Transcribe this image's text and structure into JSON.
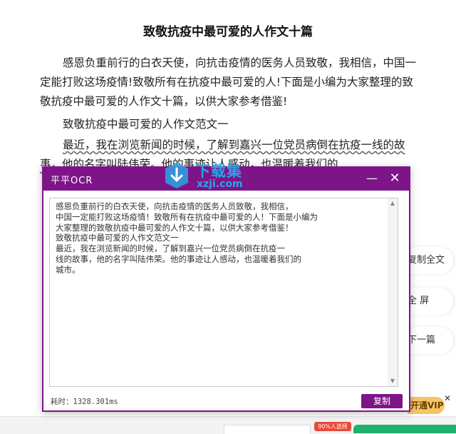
{
  "article": {
    "title": "致敬抗疫中最可爱的人作文十篇",
    "p1": "感恩负重前行的白衣天使，向抗击疫情的医务人员致敬，我相信，中国一定能打败这场疫情!致敬所有在抗疫中最可爱的人!下面是小编为大家整理的致敬抗疫中最可爱的人作文十篇，以供大家参考借鉴!",
    "p2": "致敬抗疫中最可爱的人作文范文一",
    "p3": "最近，我在浏览新闻的时候，了解到嘉兴一位党员病倒在抗疫一线的故事，他的名字叫陆伟荣。他的事迹让人感动，也温暖着我们的"
  },
  "side_actions": {
    "copy_all": "复制全文",
    "fullscreen": "全 屏",
    "next": "下一篇",
    "vip": "开通VIP"
  },
  "bottom": {
    "badge": "90%人选择"
  },
  "ocr_window": {
    "title": "平平OCR",
    "text": "感恩负重前行的白衣天使，向抗击疫情的医务人员致敬，我相信，\n中国一定能打败这场疫情！致敬所有在抗疫中最可爱的人！下面是小编为\n大家整理的致敬抗疫中最可爱的人作文十篇，以供大家参考借鉴！\n致敬抗疫中最可爱的人作文范文一\n最近，我在浏览新闻的时候，了解到嘉兴一位党员病倒在抗疫一\n线的故事，他的名字叫陆伟荣。他的事迹让人感动，也温暖着我们的\n城市。",
    "elapsed": "耗时：1328.301ms",
    "copy_button": "复制"
  },
  "watermark": {
    "line1": "下载集",
    "line2": "xzji.com"
  },
  "colors": {
    "ocr_purple": "#7d1589",
    "vip_gold": "#f4c567",
    "watermark_blue": "#2aa4e6"
  }
}
